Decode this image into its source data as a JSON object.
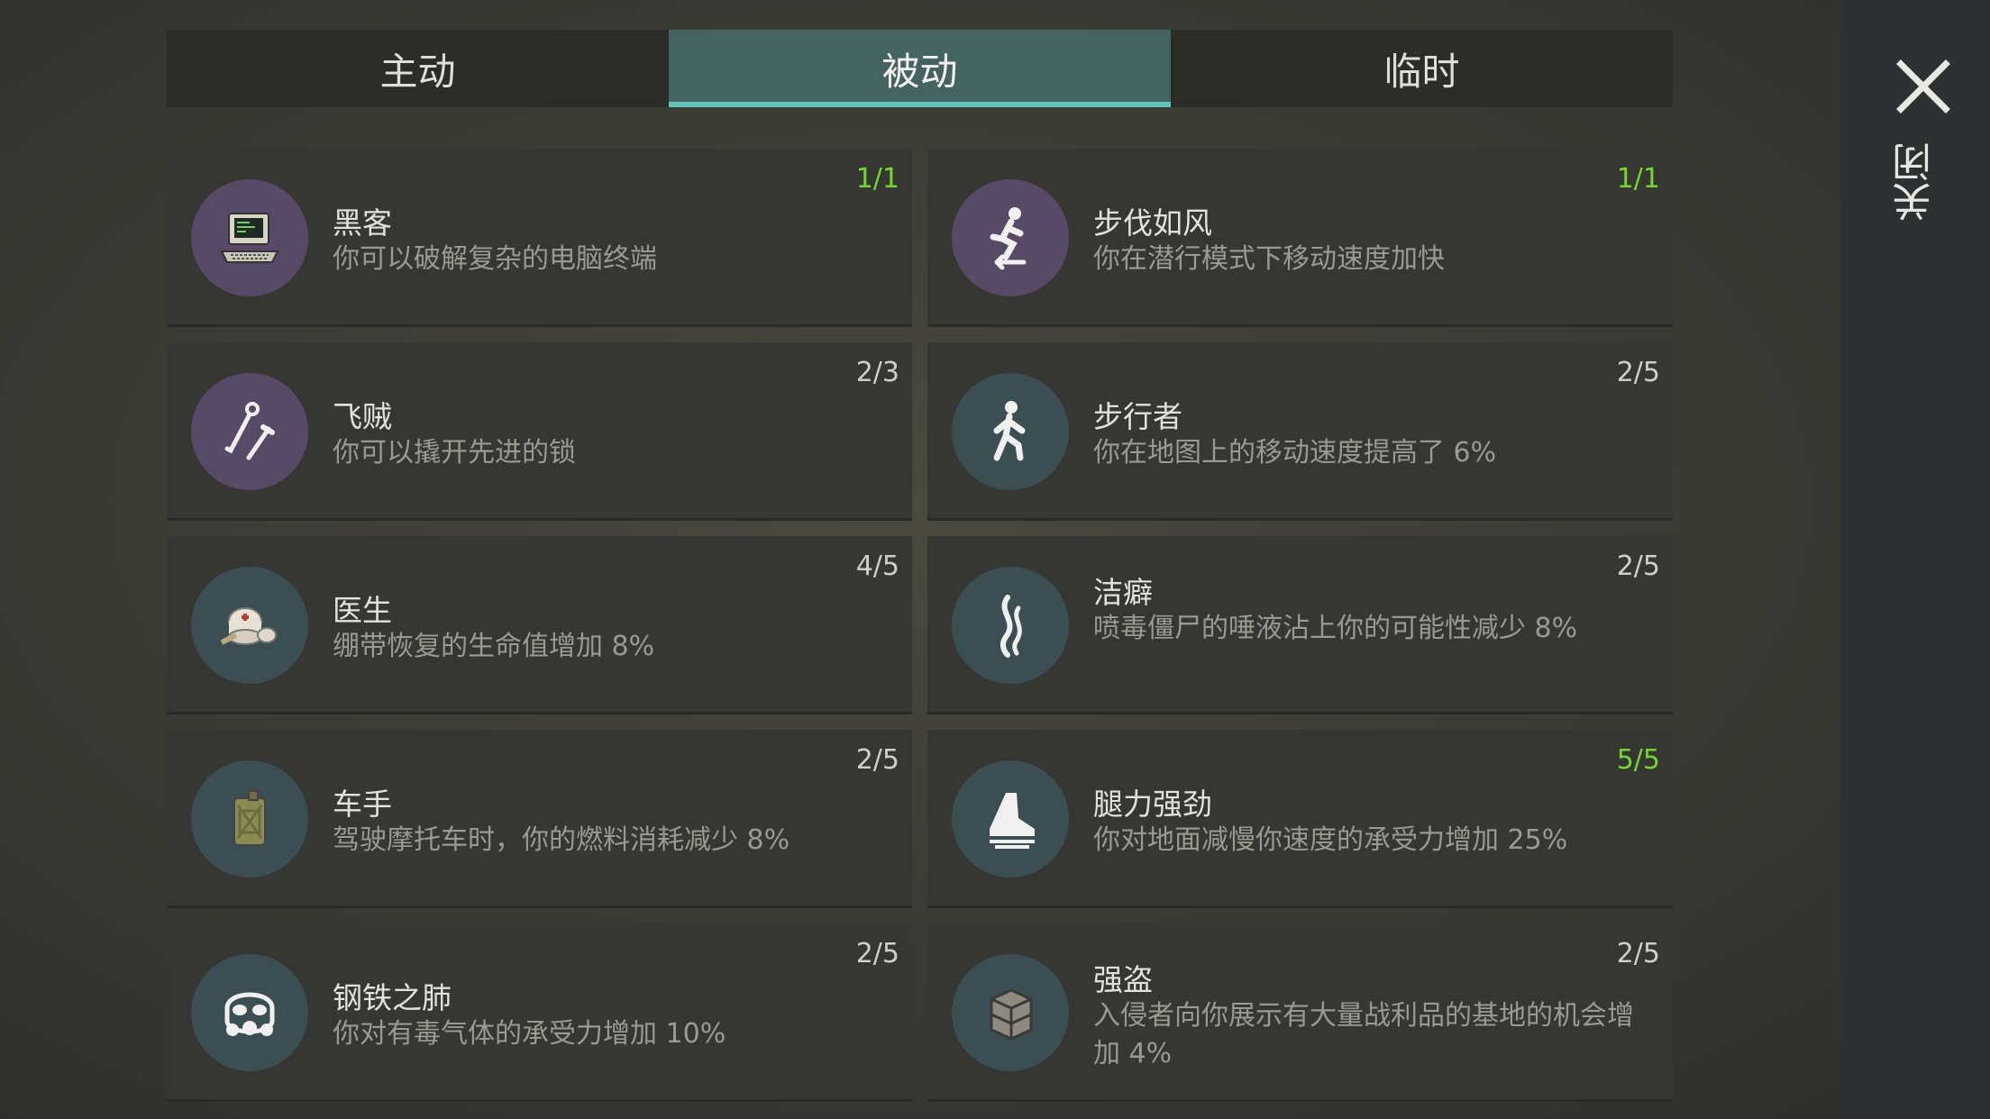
{
  "tabs": [
    {
      "label": "主动"
    },
    {
      "label": "被动"
    },
    {
      "label": "临时"
    }
  ],
  "active_tab": "被动",
  "close": {
    "label": "关闭",
    "icon": "close-icon"
  },
  "colors": {
    "accent": "#5fc4b9",
    "max_level": "#71d82e",
    "purple_icon_bg": "#574a66",
    "teal_icon_bg": "#3b4e52"
  },
  "perks": [
    {
      "title": "黑客",
      "desc": "你可以破解复杂的电脑终端",
      "level": "1/1",
      "maxed": true,
      "icon": "computer-icon",
      "icon_bg": "purple"
    },
    {
      "title": "步伐如风",
      "desc": "你在潜行模式下移动速度加快",
      "level": "1/1",
      "maxed": true,
      "icon": "sneak-runner-icon",
      "icon_bg": "purple"
    },
    {
      "title": "飞贼",
      "desc": "你可以撬开先进的锁",
      "level": "2/3",
      "maxed": false,
      "icon": "lockpick-icon",
      "icon_bg": "purple"
    },
    {
      "title": "步行者",
      "desc": "你在地图上的移动速度提高了 6%",
      "level": "2/5",
      "maxed": false,
      "icon": "walker-icon",
      "icon_bg": "teal"
    },
    {
      "title": "医生",
      "desc": "绷带恢复的生命值增加 8%",
      "level": "4/5",
      "maxed": false,
      "icon": "bandage-icon",
      "icon_bg": "teal"
    },
    {
      "title": "洁癖",
      "desc": "喷毒僵尸的唾液沾上你的可能性减少 8%",
      "level": "2/5",
      "maxed": false,
      "icon": "smoke-icon",
      "icon_bg": "teal"
    },
    {
      "title": "车手",
      "desc": "驾驶摩托车时，你的燃料消耗减少 8%",
      "level": "2/5",
      "maxed": false,
      "icon": "jerrycan-icon",
      "icon_bg": "teal"
    },
    {
      "title": "腿力强劲",
      "desc": "你对地面减慢你速度的承受力增加 25%",
      "level": "5/5",
      "maxed": true,
      "icon": "boot-icon",
      "icon_bg": "teal"
    },
    {
      "title": "钢铁之肺",
      "desc": "你对有毒气体的承受力增加 10%",
      "level": "2/5",
      "maxed": false,
      "icon": "gas-mask-icon",
      "icon_bg": "teal"
    },
    {
      "title": "强盗",
      "desc": "入侵者向你展示有大量战利品的基地的机会增加 4%",
      "level": "2/5",
      "maxed": false,
      "icon": "crate-icon",
      "icon_bg": "teal"
    }
  ]
}
